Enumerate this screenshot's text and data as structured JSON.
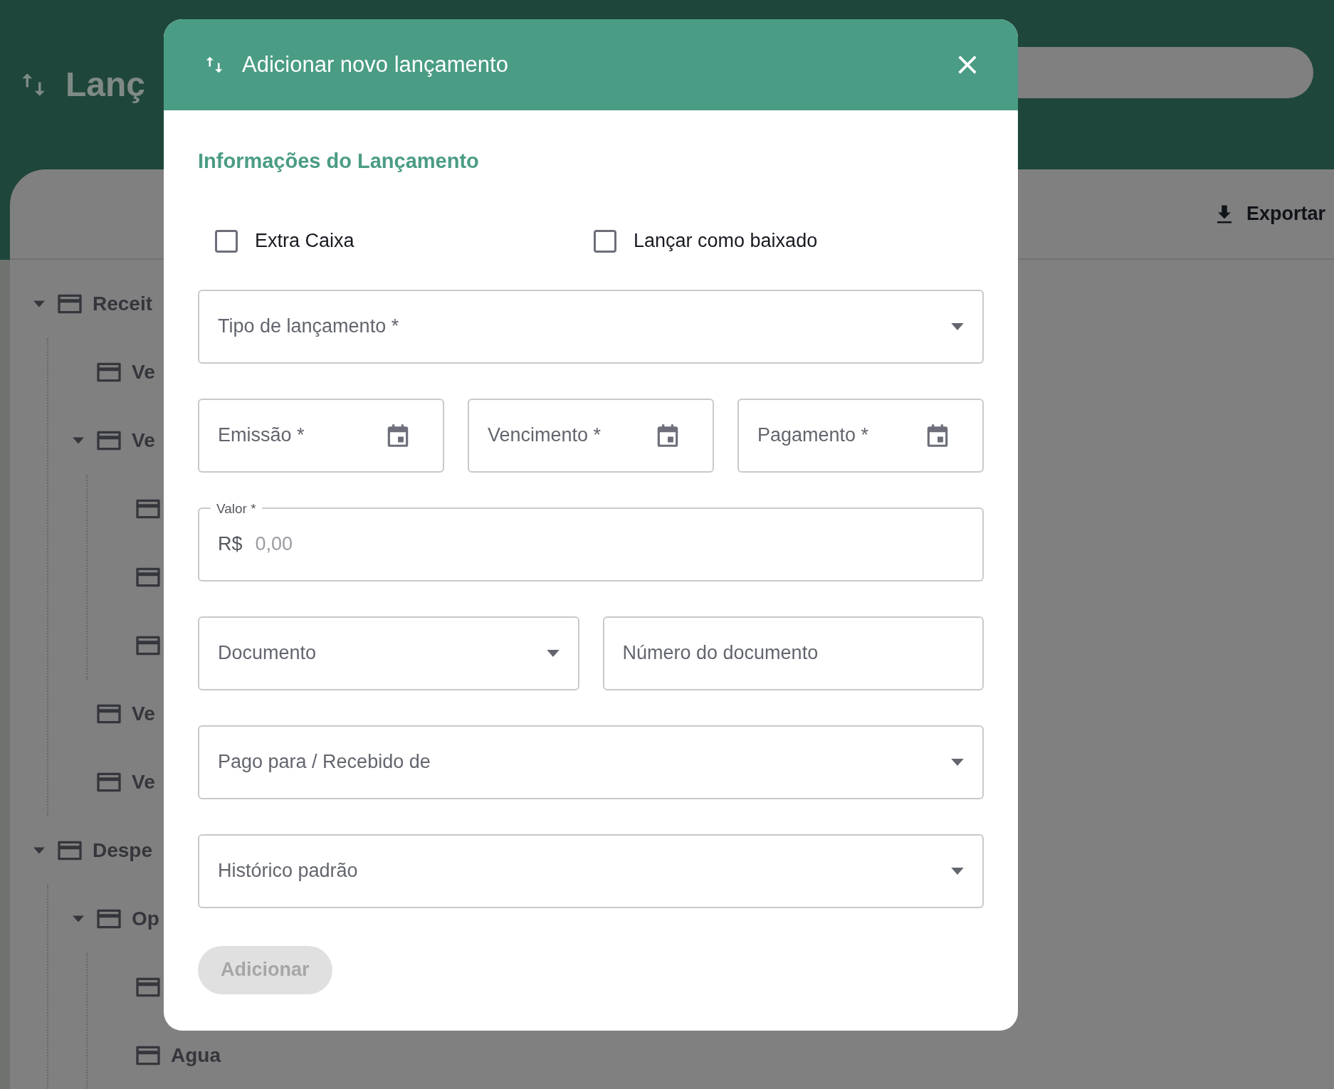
{
  "app": {
    "title": "Lanç",
    "export_label": "Exportar"
  },
  "tree": [
    {
      "kind": "account",
      "label": "Receit",
      "expanded": true,
      "children": [
        {
          "kind": "account",
          "label": "Ve"
        },
        {
          "kind": "account",
          "label": "Ve",
          "expanded": true,
          "children": [
            {
              "kind": "account"
            },
            {
              "kind": "account"
            },
            {
              "kind": "account"
            }
          ]
        },
        {
          "kind": "account",
          "label": "Ve"
        },
        {
          "kind": "account",
          "label": "Ve"
        }
      ]
    },
    {
      "kind": "account",
      "label": "Despe",
      "expanded": true,
      "children": [
        {
          "kind": "account",
          "label": "Op",
          "expanded": true,
          "children": [
            {
              "kind": "account"
            },
            {
              "kind": "account",
              "label": "Agua"
            }
          ]
        }
      ]
    }
  ],
  "dialog": {
    "title": "Adicionar novo lançamento",
    "section_title": "Informações do Lançamento",
    "checkboxes": [
      {
        "label": "Extra Caixa",
        "checked": false
      },
      {
        "label": "Lançar como baixado",
        "checked": false
      }
    ],
    "field_rows": [
      [
        {
          "kind": "select",
          "label": "Tipo de lançamento *"
        }
      ],
      [
        {
          "kind": "date",
          "label": "Emissão *"
        },
        {
          "kind": "date",
          "label": "Vencimento *"
        },
        {
          "kind": "date",
          "label": "Pagamento *"
        }
      ],
      [
        {
          "kind": "currency",
          "label": "Valor *",
          "prefix": "R$",
          "placeholder": "0,00"
        }
      ],
      [
        {
          "kind": "select",
          "label": "Documento"
        },
        {
          "kind": "text",
          "label": "Número do documento"
        }
      ],
      [
        {
          "kind": "select",
          "label": "Pago para / Recebido de"
        }
      ],
      [
        {
          "kind": "select",
          "label": "Histórico padrão"
        }
      ]
    ],
    "submit": {
      "label": "Adicionar",
      "disabled": true
    }
  }
}
